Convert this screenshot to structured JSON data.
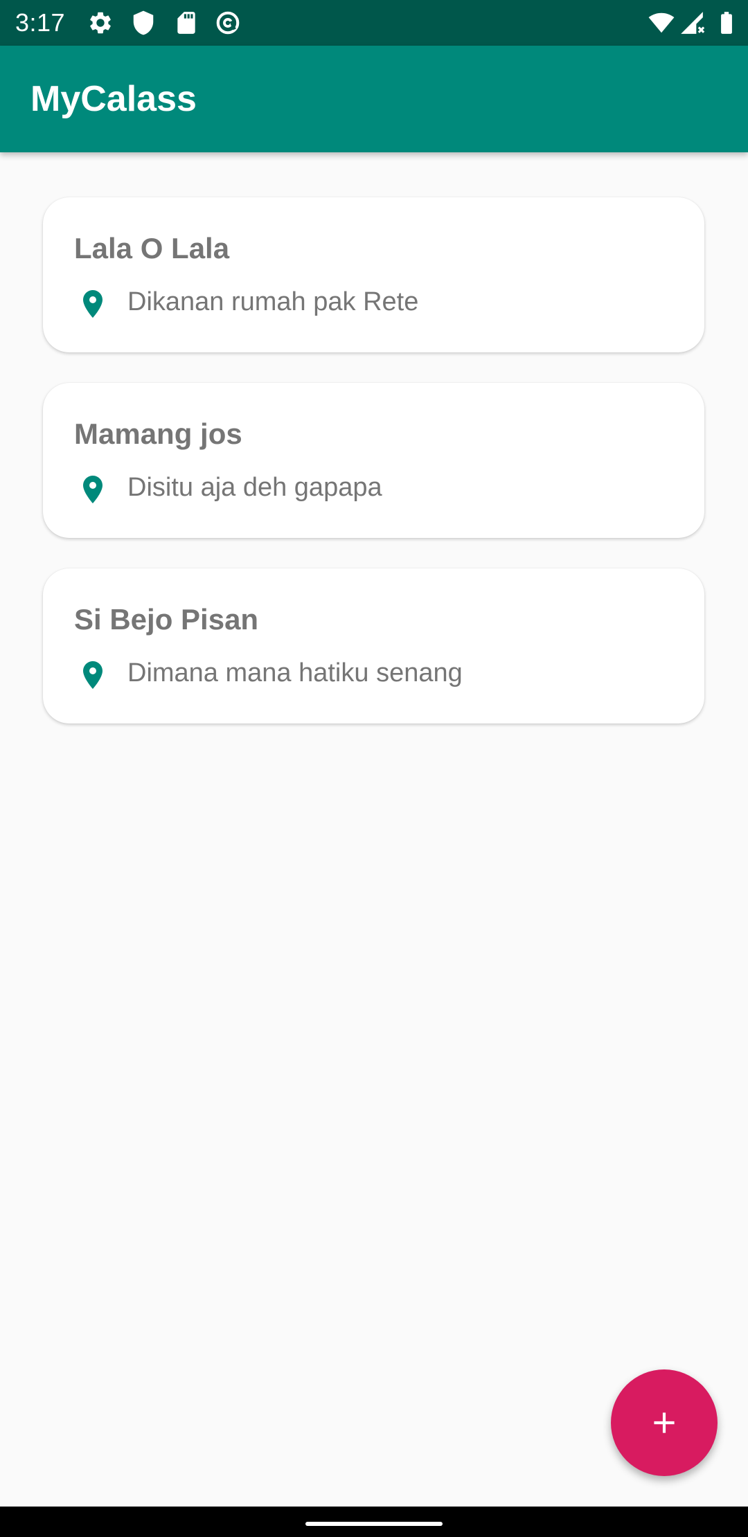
{
  "status_bar": {
    "time": "3:17",
    "left_icons": [
      "gear-icon",
      "shield-icon",
      "sd-card-icon",
      "at-sign-icon"
    ],
    "right_icons": [
      "wifi-icon",
      "signal-icon",
      "battery-icon"
    ]
  },
  "app_bar": {
    "title": "MyCalass",
    "background": "#00897b"
  },
  "items": [
    {
      "name": "Lala O Lala",
      "location": "Dikanan rumah pak Rete"
    },
    {
      "name": "Mamang jos",
      "location": "Disitu aja deh gapapa"
    },
    {
      "name": "Si Bejo Pisan",
      "location": "Dimana mana hatiku senang"
    }
  ],
  "fab": {
    "icon": "plus-icon",
    "color": "#d81b60"
  },
  "colors": {
    "status_bar": "#00574b",
    "accent": "#00897b",
    "pin": "#00897b"
  }
}
